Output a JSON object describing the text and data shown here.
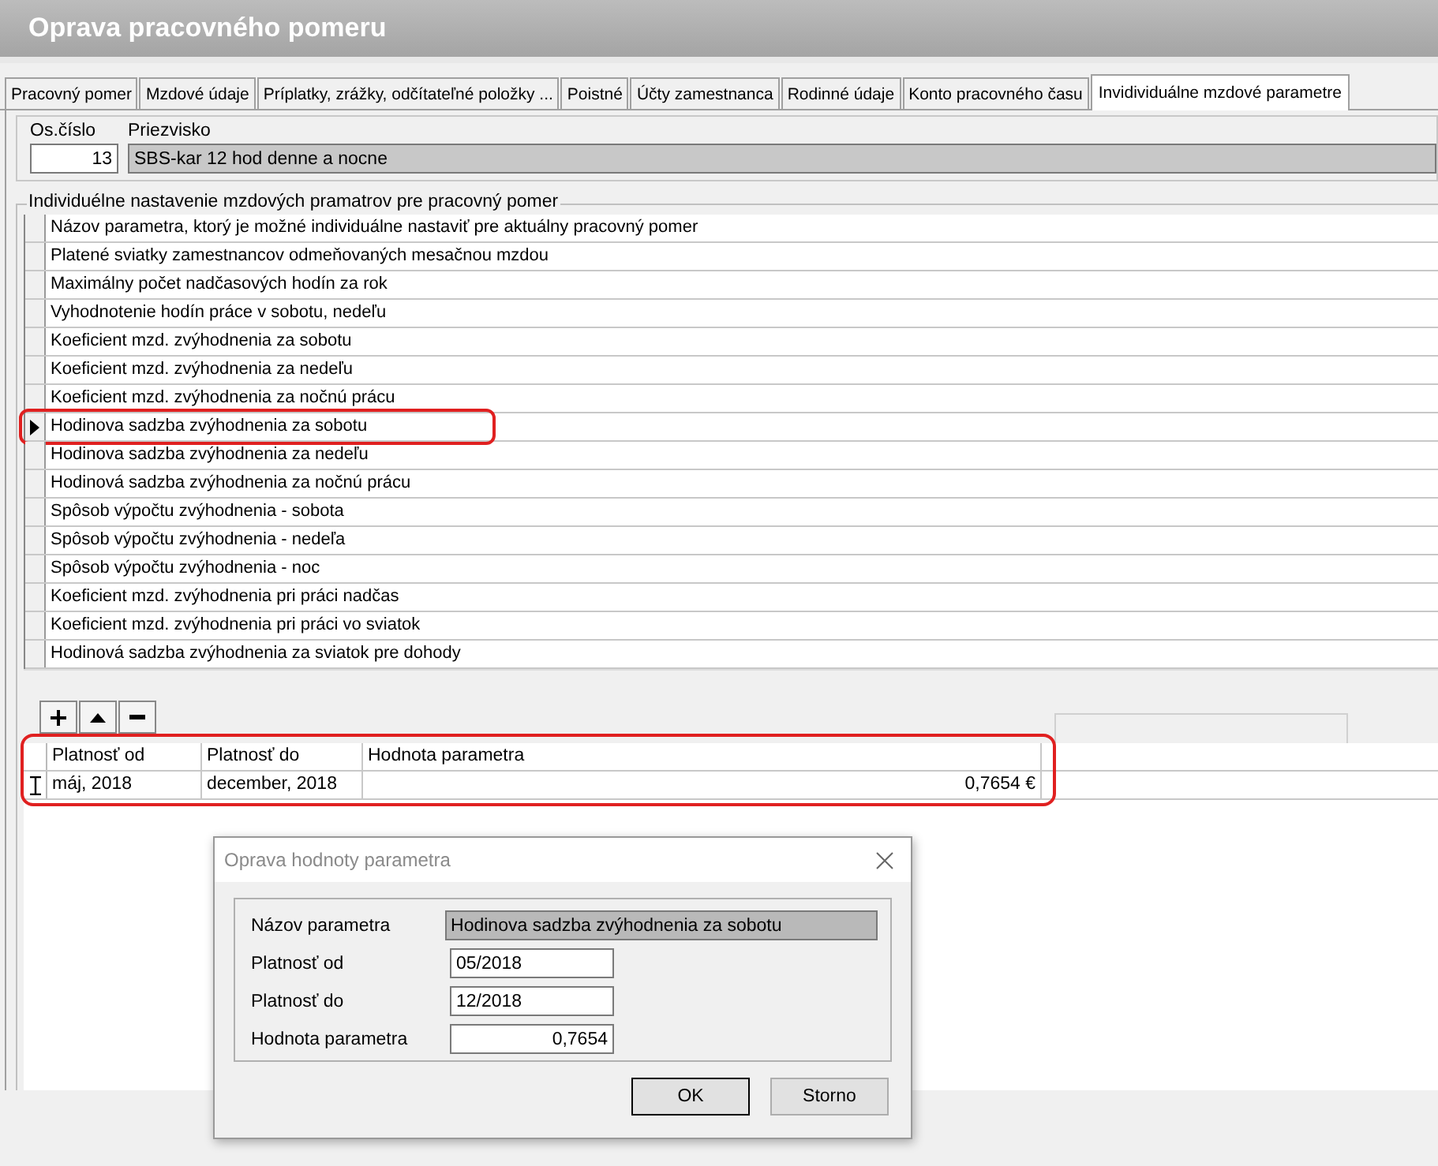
{
  "window": {
    "title": "Oprava pracovného pomeru"
  },
  "tabs": [
    {
      "label": "Pracovný pomer",
      "selected": false
    },
    {
      "label": "Mzdové údaje",
      "selected": false
    },
    {
      "label": "Príplatky, zrážky, odčítateľné položky ...",
      "selected": false
    },
    {
      "label": "Poistné",
      "selected": false
    },
    {
      "label": "Účty zamestnanca",
      "selected": false
    },
    {
      "label": "Rodinné údaje",
      "selected": false
    },
    {
      "label": "Konto pracovného času",
      "selected": false
    },
    {
      "label": "Invidividuálne mzdové parametre",
      "selected": true
    }
  ],
  "employee": {
    "number_label": "Os.číslo",
    "number": "13",
    "surname_label": "Priezvisko",
    "surname": "SBS-kar 12 hod denne a nocne"
  },
  "parameters": {
    "title": "Individuélne nastavenie mzdových pramatrov pre pracovný pomer",
    "header": "Názov parametra, ktorý je možné individuálne nastaviť pre aktuálny pracovný pomer",
    "rows": [
      {
        "name": "Platené sviatky zamestnancov odmeňovaných mesačnou mzdou",
        "selected": false,
        "highlighted": false
      },
      {
        "name": "Maximálny počet nadčasových hodín za rok",
        "selected": false,
        "highlighted": false
      },
      {
        "name": "Vyhodnotenie hodín práce v sobotu, nedeľu",
        "selected": false,
        "highlighted": false
      },
      {
        "name": "Koeficient mzd. zvýhodnenia za sobotu",
        "selected": false,
        "highlighted": false
      },
      {
        "name": "Koeficient mzd. zvýhodnenia za nedeľu",
        "selected": false,
        "highlighted": false
      },
      {
        "name": "Koeficient mzd. zvýhodnenia za nočnú prácu",
        "selected": false,
        "highlighted": false
      },
      {
        "name": "Hodinova sadzba zvýhodnenia za sobotu",
        "selected": true,
        "highlighted": true
      },
      {
        "name": "Hodinova sadzba zvýhodnenia za nedeľu",
        "selected": false,
        "highlighted": false
      },
      {
        "name": "Hodinová sadzba zvýhodnenia za nočnú prácu",
        "selected": false,
        "highlighted": false
      },
      {
        "name": "Spôsob výpočtu zvýhodnenia - sobota",
        "selected": false,
        "highlighted": false
      },
      {
        "name": "Spôsob výpočtu zvýhodnenia - nedeľa",
        "selected": false,
        "highlighted": false
      },
      {
        "name": "Spôsob výpočtu zvýhodnenia - noc",
        "selected": false,
        "highlighted": false
      },
      {
        "name": "Koeficient mzd. zvýhodnenia pri práci nadčas",
        "selected": false,
        "highlighted": false
      },
      {
        "name": "Koeficient mzd. zvýhodnenia pri práci vo sviatok",
        "selected": false,
        "highlighted": false
      },
      {
        "name": "Hodinová sadzba zvýhodnenia za sviatok pre dohody",
        "selected": false,
        "highlighted": false
      }
    ]
  },
  "toolbar": [
    {
      "kind": "add"
    },
    {
      "kind": "up"
    },
    {
      "kind": "remove"
    }
  ],
  "values": {
    "highlighted": true,
    "columns": [
      "Platnosť od",
      "Platnosť do",
      "Hodnota parametra"
    ],
    "rows": [
      {
        "from": "máj, 2018",
        "to": "december, 2018",
        "value": "0,7654 €",
        "editing": true
      }
    ]
  },
  "dialog": {
    "title": "Oprava hodnoty parametra",
    "fields": [
      {
        "label": "Názov parametra",
        "value": "Hodinova sadzba zvýhodnenia za sobotu",
        "disabled": true,
        "kind": "text"
      },
      {
        "label": "Platnosť od",
        "value": "05/2018",
        "disabled": false,
        "kind": "text"
      },
      {
        "label": "Platnosť do",
        "value": "12/2018",
        "disabled": false,
        "kind": "text"
      },
      {
        "label": "Hodnota parametra",
        "value": "0,7654",
        "disabled": false,
        "kind": "number"
      }
    ],
    "buttons": [
      {
        "label": "OK",
        "default": true
      },
      {
        "label": "Storno",
        "default": false
      }
    ]
  }
}
